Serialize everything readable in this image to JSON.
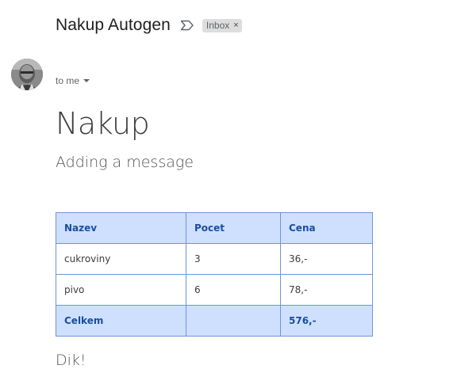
{
  "email": {
    "subject": "Nakup Autogen",
    "label": "Inbox",
    "label_close": "×",
    "recipient": "to me",
    "avatar_icon": "person-photo-icon",
    "important_icon": "importance-marker-icon"
  },
  "body": {
    "heading": "Nakup",
    "subheading": "Adding a message",
    "table": {
      "headers": [
        "Nazev",
        "Pocet",
        "Cena"
      ],
      "rows": [
        [
          "cukroviny",
          "3",
          "36,-"
        ],
        [
          "pivo",
          "6",
          "78,-"
        ]
      ],
      "total": [
        "Celkem",
        "",
        "576,-"
      ]
    },
    "closing": "Dik!"
  },
  "colors": {
    "table_header_bg": "#cfe0ff",
    "table_header_text": "#1a4fa0",
    "table_border": "#6d94e0",
    "label_chip_bg": "#dddddd"
  }
}
